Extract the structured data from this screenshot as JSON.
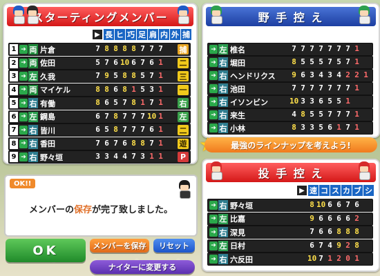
{
  "starting": {
    "title": "スターティングメンバー",
    "columns": [
      "長",
      "ヒ",
      "巧",
      "足",
      "肩",
      "内",
      "外",
      "捕"
    ],
    "players": [
      {
        "num": "1",
        "hand": "両",
        "name": "片倉",
        "stats": [
          "7",
          "8",
          "8",
          "8",
          "8",
          "7",
          "7",
          "7"
        ],
        "pos": "捕",
        "posColor": "o"
      },
      {
        "num": "2",
        "hand": "両",
        "name": "佐田",
        "stats": [
          "5",
          "7",
          "6",
          "10",
          "6",
          "7",
          "6",
          "1"
        ],
        "pos": "二",
        "posColor": "y"
      },
      {
        "num": "3",
        "hand": "左",
        "name": "久我",
        "stats": [
          "7",
          "9",
          "5",
          "8",
          "8",
          "5",
          "7",
          "1"
        ],
        "pos": "三",
        "posColor": "y"
      },
      {
        "num": "4",
        "hand": "両",
        "name": "マイケル",
        "stats": [
          "8",
          "8",
          "6",
          "8",
          "1",
          "5",
          "3",
          "1"
        ],
        "pos": "一",
        "posColor": "y"
      },
      {
        "num": "5",
        "hand": "右",
        "name": "有働",
        "stats": [
          "8",
          "6",
          "5",
          "7",
          "8",
          "1",
          "7",
          "1"
        ],
        "pos": "右",
        "posColor": "g"
      },
      {
        "num": "6",
        "hand": "左",
        "name": "鋼島",
        "stats": [
          "6",
          "7",
          "8",
          "7",
          "7",
          "7",
          "10",
          "1"
        ],
        "pos": "左",
        "posColor": "g"
      },
      {
        "num": "7",
        "hand": "右",
        "name": "皆川",
        "stats": [
          "6",
          "5",
          "8",
          "7",
          "7",
          "7",
          "6",
          "1"
        ],
        "pos": "二",
        "posColor": "y"
      },
      {
        "num": "8",
        "hand": "右",
        "name": "香田",
        "stats": [
          "7",
          "6",
          "7",
          "6",
          "8",
          "8",
          "7",
          "1"
        ],
        "pos": "遊",
        "posColor": "y"
      },
      {
        "num": "9",
        "hand": "右",
        "name": "野々垣",
        "stats": [
          "3",
          "3",
          "4",
          "4",
          "7",
          "3",
          "1",
          "1"
        ],
        "pos": "P",
        "posColor": "r"
      }
    ]
  },
  "bench": {
    "title": "野 手 控 え",
    "players": [
      {
        "hand": "左",
        "name": "椎名",
        "stats": [
          "7",
          "7",
          "7",
          "7",
          "7",
          "7",
          "7",
          "1"
        ]
      },
      {
        "hand": "右",
        "name": "堀田",
        "stats": [
          "8",
          "5",
          "5",
          "5",
          "7",
          "5",
          "7",
          "1"
        ]
      },
      {
        "hand": "右",
        "name": "ヘンドリクス",
        "stats": [
          "9",
          "6",
          "3",
          "4",
          "3",
          "4",
          "2",
          "2",
          "1"
        ]
      },
      {
        "hand": "右",
        "name": "池田",
        "stats": [
          "7",
          "7",
          "7",
          "7",
          "7",
          "7",
          "7",
          "1"
        ]
      },
      {
        "hand": "右",
        "name": "イソンビン",
        "stats": [
          "10",
          "3",
          "3",
          "6",
          "5",
          "5",
          "1"
        ]
      },
      {
        "hand": "右",
        "name": "来生",
        "stats": [
          "4",
          "8",
          "5",
          "5",
          "7",
          "7",
          "7",
          "1"
        ]
      },
      {
        "hand": "右",
        "name": "小林",
        "stats": [
          "8",
          "3",
          "3",
          "5",
          "6",
          "1",
          "7",
          "1"
        ]
      }
    ]
  },
  "banner": "最強のラインナップを考えよう!",
  "pitchers": {
    "title": "投 手 控 え",
    "columns": [
      "速",
      "コ",
      "ス",
      "カ",
      "ブ",
      "シ"
    ],
    "players": [
      {
        "hand": "右",
        "name": "野々垣",
        "stats": [
          "8",
          "10",
          "6",
          "6",
          "7",
          "6"
        ]
      },
      {
        "hand": "左",
        "name": "比嘉",
        "stats": [
          "9",
          "6",
          "6",
          "6",
          "6",
          "2"
        ]
      },
      {
        "hand": "右",
        "name": "深見",
        "stats": [
          "7",
          "6",
          "6",
          "8",
          "8",
          "8"
        ]
      },
      {
        "hand": "左",
        "name": "日村",
        "stats": [
          "6",
          "7",
          "4",
          "9",
          "2",
          "8"
        ]
      },
      {
        "hand": "右",
        "name": "六反田",
        "stats": [
          "10",
          "7",
          "1",
          "2",
          "0",
          "1"
        ]
      }
    ]
  },
  "message": {
    "tag": "OK!!",
    "text_before": "メンバーの",
    "text_em": "保存",
    "text_after": "が完了致しました。"
  },
  "buttons": {
    "ok": "OK",
    "save": "メンバーを保存",
    "reset": "リセット",
    "night": "ナイターに変更する"
  }
}
